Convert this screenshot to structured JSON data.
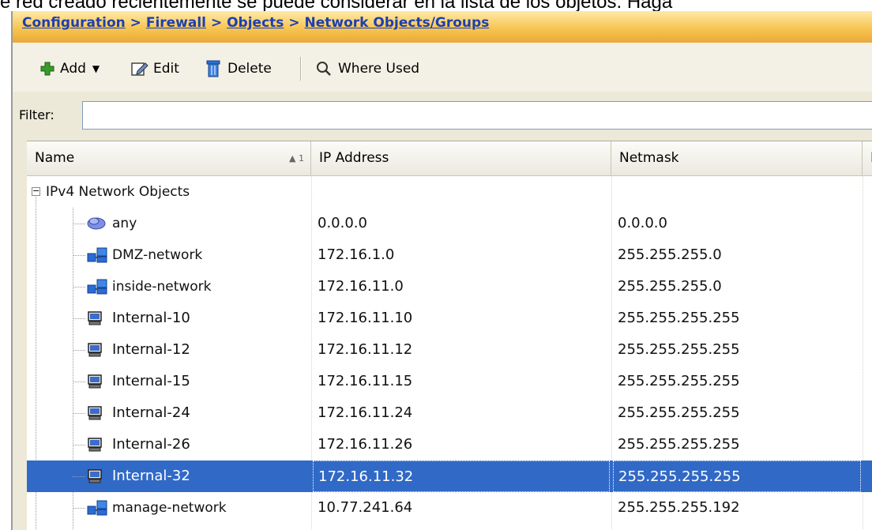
{
  "page_caption": "e red creado recientemente se puede considerar en la lista de los objetos. Haga",
  "breadcrumb": {
    "items": [
      "Configuration",
      "Firewall",
      "Objects",
      "Network Objects/Groups"
    ],
    "separator": ">"
  },
  "toolbar": {
    "add_label": "Add",
    "edit_label": "Edit",
    "delete_label": "Delete",
    "where_used_label": "Where Used"
  },
  "filter": {
    "label": "Filter:",
    "value": ""
  },
  "table": {
    "columns": {
      "name": "Name",
      "sort_indicator": "▲ 1",
      "ip": "IP Address",
      "netmask": "Netmask",
      "extra": "D"
    },
    "group": {
      "label": "IPv4 Network Objects",
      "expander": "−"
    },
    "rows": [
      {
        "name": "any",
        "icon": "cloud-icon",
        "ip": "0.0.0.0",
        "netmask": "0.0.0.0"
      },
      {
        "name": "DMZ-network",
        "icon": "network-icon",
        "ip": "172.16.1.0",
        "netmask": "255.255.255.0"
      },
      {
        "name": "inside-network",
        "icon": "network-icon",
        "ip": "172.16.11.0",
        "netmask": "255.255.255.0"
      },
      {
        "name": "Internal-10",
        "icon": "host-icon",
        "ip": "172.16.11.10",
        "netmask": "255.255.255.255"
      },
      {
        "name": "Internal-12",
        "icon": "host-icon",
        "ip": "172.16.11.12",
        "netmask": "255.255.255.255"
      },
      {
        "name": "Internal-15",
        "icon": "host-icon",
        "ip": "172.16.11.15",
        "netmask": "255.255.255.255"
      },
      {
        "name": "Internal-24",
        "icon": "host-icon",
        "ip": "172.16.11.24",
        "netmask": "255.255.255.255"
      },
      {
        "name": "Internal-26",
        "icon": "host-icon",
        "ip": "172.16.11.26",
        "netmask": "255.255.255.255"
      },
      {
        "name": "Internal-32",
        "icon": "host-icon",
        "ip": "172.16.11.32",
        "netmask": "255.255.255.255",
        "selected": true
      },
      {
        "name": "manage-network",
        "icon": "network-icon",
        "ip": "10.77.241.64",
        "netmask": "255.255.255.192"
      }
    ]
  },
  "colors": {
    "breadcrumb_link": "#1d3fb0",
    "selection": "#3169c6",
    "header_bar": "#f6c24c"
  }
}
